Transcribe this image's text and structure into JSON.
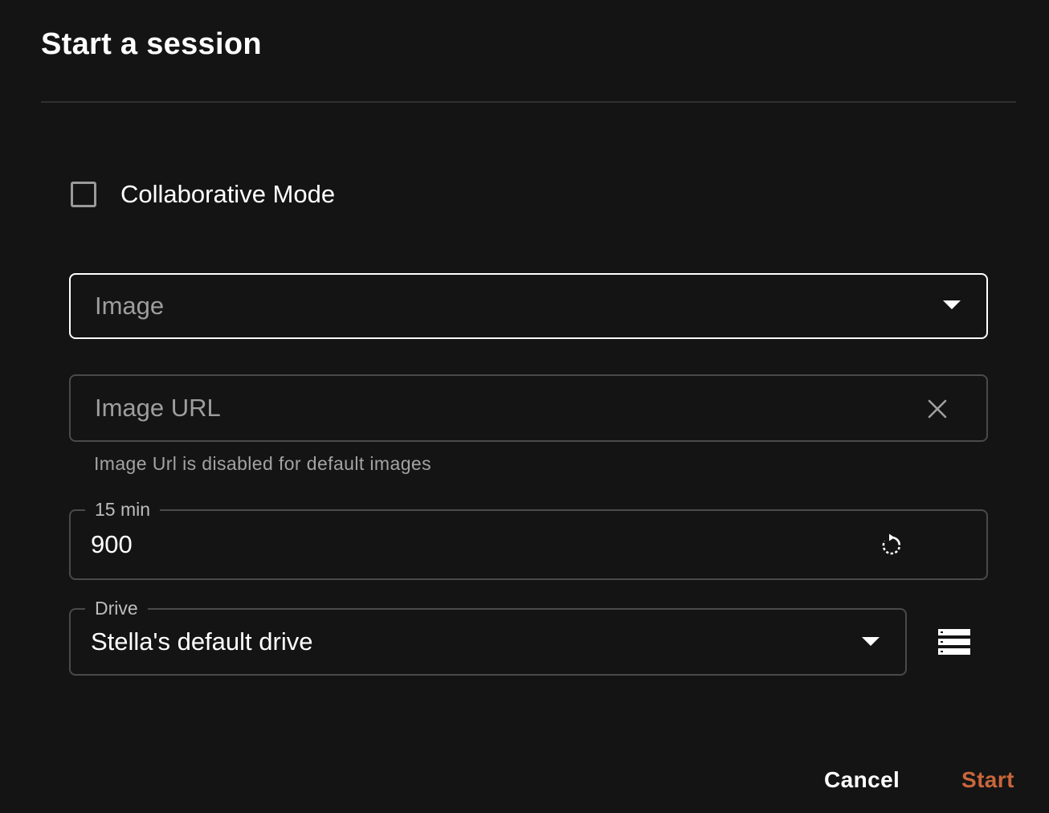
{
  "dialog": {
    "title": "Start a session"
  },
  "collaborative": {
    "label": "Collaborative Mode",
    "checked": false
  },
  "image_select": {
    "placeholder": "Image"
  },
  "image_url": {
    "placeholder": "Image URL",
    "helper": "Image Url is disabled for default images"
  },
  "timeout": {
    "label": "15 min",
    "value": "900"
  },
  "drive": {
    "label": "Drive",
    "value": "Stella's default drive"
  },
  "actions": {
    "cancel": "Cancel",
    "start": "Start"
  },
  "colors": {
    "background": "#141414",
    "accent": "#c8663b",
    "border": "#4a4a4a"
  },
  "icons": {
    "image_dropdown": "caret-down-icon",
    "url_clear": "close-icon",
    "timeout_reset": "reset-icon",
    "drive_dropdown": "caret-down-icon",
    "drive_manage": "storage-icon"
  }
}
